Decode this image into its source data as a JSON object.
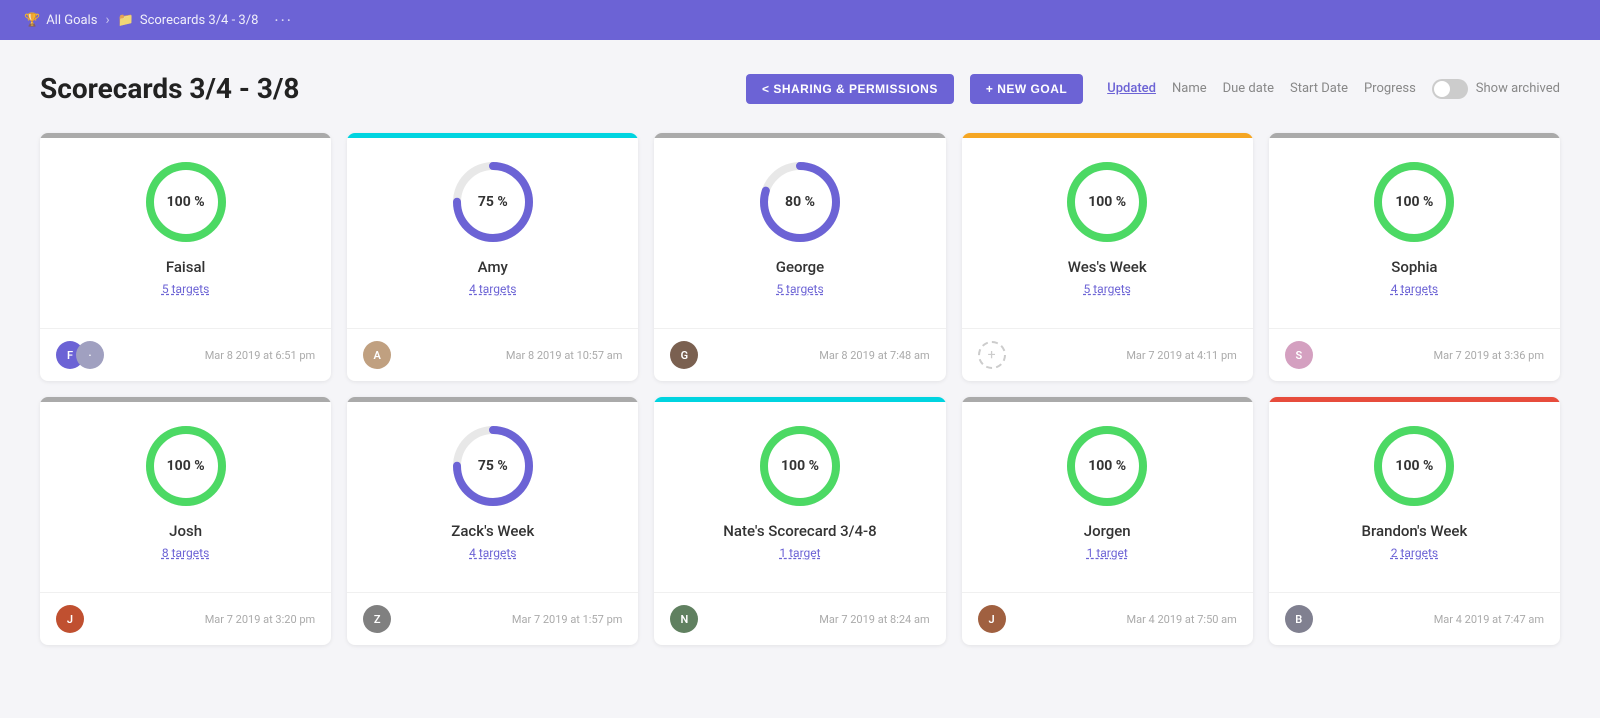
{
  "nav": {
    "all_goals_label": "All Goals",
    "breadcrumb_label": "Scorecards 3/4 - 3/8",
    "dots": "···"
  },
  "page": {
    "title": "Scorecards 3/4 - 3/8",
    "sharing_button": "< SHARING & PERMISSIONS",
    "new_goal_button": "+ NEW GOAL"
  },
  "sort": {
    "options": [
      {
        "key": "updated",
        "label": "Updated",
        "active": true
      },
      {
        "key": "name",
        "label": "Name",
        "active": false
      },
      {
        "key": "due_date",
        "label": "Due date",
        "active": false
      },
      {
        "key": "start_date",
        "label": "Start Date",
        "active": false
      },
      {
        "key": "progress",
        "label": "Progress",
        "active": false
      }
    ],
    "show_archived_label": "Show archived"
  },
  "cards": [
    {
      "id": "faisal",
      "name": "Faisal",
      "targets": "5 targets",
      "progress": 100,
      "progress_label": "100 %",
      "timestamp": "Mar 8 2019 at 6:51 pm",
      "bar_color": "#aaa",
      "circle_color_fg": "#4cd964",
      "circle_color_bg": "#e8e8e8",
      "avatar_colors": [
        "#6c63d5",
        "#a0a0c0"
      ],
      "avatar_initials": [
        "F",
        "·"
      ]
    },
    {
      "id": "amy",
      "name": "Amy",
      "targets": "4 targets",
      "progress": 75,
      "progress_label": "75 %",
      "timestamp": "Mar 8 2019 at 10:57 am",
      "bar_color": "#00d4e0",
      "circle_color_fg": "#6c63d5",
      "circle_color_bg": "#e8e8e8",
      "avatar_colors": [
        "#c0a080"
      ],
      "avatar_initials": [
        "A"
      ]
    },
    {
      "id": "george",
      "name": "George",
      "targets": "5 targets",
      "progress": 80,
      "progress_label": "80 %",
      "timestamp": "Mar 8 2019 at 7:48 am",
      "bar_color": "#aaa",
      "circle_color_fg": "#6c63d5",
      "circle_color_bg": "#e8e8e8",
      "avatar_colors": [
        "#7a6050"
      ],
      "avatar_initials": [
        "G"
      ]
    },
    {
      "id": "wes-week",
      "name": "Wes's Week",
      "targets": "5 targets",
      "progress": 100,
      "progress_label": "100 %",
      "timestamp": "Mar 7 2019 at 4:11 pm",
      "bar_color": "#f5a623",
      "circle_color_fg": "#4cd964",
      "circle_color_bg": "#e8e8e8",
      "avatar_colors": [],
      "avatar_initials": [],
      "placeholder_avatar": true
    },
    {
      "id": "sophia",
      "name": "Sophia",
      "targets": "4 targets",
      "progress": 100,
      "progress_label": "100 %",
      "timestamp": "Mar 7 2019 at 3:36 pm",
      "bar_color": "#aaa",
      "circle_color_fg": "#4cd964",
      "circle_color_bg": "#e8e8e8",
      "avatar_colors": [
        "#d4a0c0"
      ],
      "avatar_initials": [
        "S"
      ]
    },
    {
      "id": "josh",
      "name": "Josh",
      "targets": "8 targets",
      "progress": 100,
      "progress_label": "100 %",
      "timestamp": "Mar 7 2019 at 3:20 pm",
      "bar_color": "#aaa",
      "circle_color_fg": "#4cd964",
      "circle_color_bg": "#e8e8e8",
      "avatar_colors": [
        "#c05030"
      ],
      "avatar_initials": [
        "J"
      ]
    },
    {
      "id": "zack-week",
      "name": "Zack's Week",
      "targets": "4 targets",
      "progress": 75,
      "progress_label": "75 %",
      "timestamp": "Mar 7 2019 at 1:57 pm",
      "bar_color": "#aaa",
      "circle_color_fg": "#6c63d5",
      "circle_color_bg": "#e8e8e8",
      "avatar_colors": [
        "#808080"
      ],
      "avatar_initials": [
        "Z"
      ]
    },
    {
      "id": "nate-scorecard",
      "name": "Nate's Scorecard 3/4-8",
      "targets": "1 target",
      "progress": 100,
      "progress_label": "100 %",
      "timestamp": "Mar 7 2019 at 8:24 am",
      "bar_color": "#00d4e0",
      "circle_color_fg": "#4cd964",
      "circle_color_bg": "#e8e8e8",
      "avatar_colors": [
        "#608060"
      ],
      "avatar_initials": [
        "N"
      ]
    },
    {
      "id": "jorgen",
      "name": "Jorgen",
      "targets": "1 target",
      "progress": 100,
      "progress_label": "100 %",
      "timestamp": "Mar 4 2019 at 7:50 am",
      "bar_color": "#aaa",
      "circle_color_fg": "#4cd964",
      "circle_color_bg": "#e8e8e8",
      "avatar_colors": [
        "#a06040"
      ],
      "avatar_initials": [
        "J"
      ]
    },
    {
      "id": "brandon-week",
      "name": "Brandon's Week",
      "targets": "2 targets",
      "progress": 100,
      "progress_label": "100 %",
      "timestamp": "Mar 4 2019 at 7:47 am",
      "bar_color": "#e74c3c",
      "circle_color_fg": "#4cd964",
      "circle_color_bg": "#e8e8e8",
      "avatar_colors": [
        "#808090"
      ],
      "avatar_initials": [
        "B"
      ]
    }
  ]
}
